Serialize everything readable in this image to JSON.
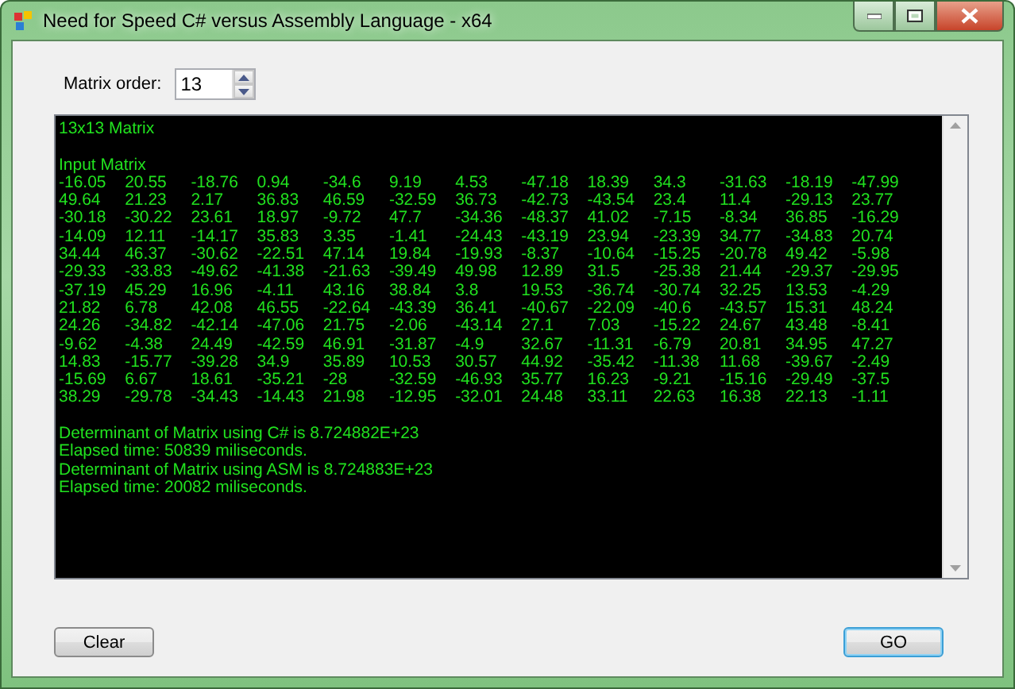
{
  "window": {
    "title": "Need for Speed C# versus Assembly Language - x64"
  },
  "matrix_order": {
    "label": "Matrix order:",
    "value": "13"
  },
  "output": {
    "heading": "13x13 Matrix",
    "section": "Input Matrix",
    "rows": [
      [
        "-16.05",
        "20.55",
        "-18.76",
        "0.94",
        "-34.6",
        "9.19",
        "4.53",
        "-47.18",
        "18.39",
        "34.3",
        "-31.63",
        "-18.19",
        "-47.99"
      ],
      [
        "49.64",
        "21.23",
        "2.17",
        "36.83",
        "46.59",
        "-32.59",
        "36.73",
        "-42.73",
        "-43.54",
        "23.4",
        "11.4",
        "-29.13",
        "23.77"
      ],
      [
        "-30.18",
        "-30.22",
        "23.61",
        "18.97",
        "-9.72",
        "47.7",
        "-34.36",
        "-48.37",
        "41.02",
        "-7.15",
        "-8.34",
        "36.85",
        "-16.29"
      ],
      [
        "-14.09",
        "12.11",
        "-14.17",
        "35.83",
        "3.35",
        "-1.41",
        "-24.43",
        "-43.19",
        "23.94",
        "-23.39",
        "34.77",
        "-34.83",
        "20.74"
      ],
      [
        "34.44",
        "46.37",
        "-30.62",
        "-22.51",
        "47.14",
        "19.84",
        "-19.93",
        "-8.37",
        "-10.64",
        "-15.25",
        "-20.78",
        "49.42",
        "-5.98"
      ],
      [
        "-29.33",
        "-33.83",
        "-49.62",
        "-41.38",
        "-21.63",
        "-39.49",
        "49.98",
        "12.89",
        "31.5",
        "-25.38",
        "21.44",
        "-29.37",
        "-29.95"
      ],
      [
        "-37.19",
        "45.29",
        "16.96",
        "-4.11",
        "43.16",
        "38.84",
        "3.8",
        "19.53",
        "-36.74",
        "-30.74",
        "32.25",
        "13.53",
        "-4.29"
      ],
      [
        "21.82",
        "6.78",
        "42.08",
        "46.55",
        "-22.64",
        "-43.39",
        "36.41",
        "-40.67",
        "-22.09",
        "-40.6",
        "-43.57",
        "15.31",
        "48.24"
      ],
      [
        "24.26",
        "-34.82",
        "-42.14",
        "-47.06",
        "21.75",
        "-2.06",
        "-43.14",
        "27.1",
        "7.03",
        "-15.22",
        "24.67",
        "43.48",
        "-8.41"
      ],
      [
        "-9.62",
        "-4.38",
        "24.49",
        "-42.59",
        "46.91",
        "-31.87",
        "-4.9",
        "32.67",
        "-11.31",
        "-6.79",
        "20.81",
        "34.95",
        "47.27"
      ],
      [
        "14.83",
        "-15.77",
        "-39.28",
        "34.9",
        "35.89",
        "10.53",
        "30.57",
        "44.92",
        "-35.42",
        "-11.38",
        "11.68",
        "-39.67",
        "-2.49"
      ],
      [
        "-15.69",
        "6.67",
        "18.61",
        "-35.21",
        "-28",
        "-32.59",
        "-46.93",
        "35.77",
        "16.23",
        "-9.21",
        "-15.16",
        "-29.49",
        "-37.5"
      ],
      [
        "38.29",
        "-29.78",
        "-34.43",
        "-14.43",
        "21.98",
        "-12.95",
        "-32.01",
        "24.48",
        "33.11",
        "22.63",
        "16.38",
        "22.13",
        "-1.11"
      ]
    ],
    "results": [
      "Determinant of Matrix using C# is 8.724882E+23",
      "Elapsed time: 50839 miliseconds.",
      "Determinant of Matrix using ASM is 8.724883E+23",
      "Elapsed time: 20082 miliseconds."
    ]
  },
  "buttons": [
    {
      "label": "Clear",
      "focused": false
    },
    {
      "label": "GO",
      "focused": true
    }
  ]
}
